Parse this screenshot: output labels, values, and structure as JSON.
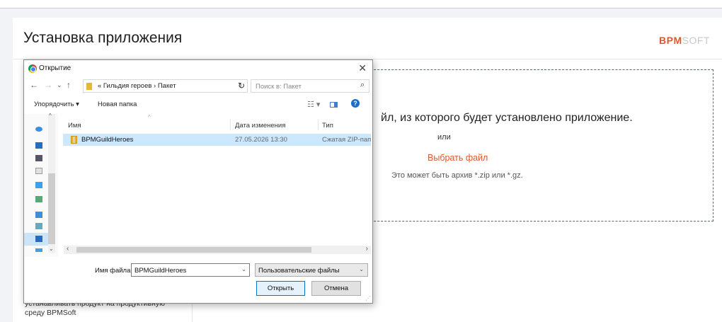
{
  "page": {
    "title": "Установка приложения",
    "brand_part1": "BPM",
    "brand_part2": "SOFT"
  },
  "drop_zone": {
    "heading": "йл, из которого будет установлено приложение.",
    "or": "или",
    "choose_file": "Выбрать файл",
    "hint": "Это может быть архив *.zip или *.gz."
  },
  "side_text": "устанавливать продукт на продуктивную среду BPMSoft",
  "dialog": {
    "title": "Открытие",
    "close": "✕",
    "breadcrumb": "« Гильдия героев › Пакет",
    "search_placeholder": "Поиск в: Пакет",
    "organize": "Упорядочить ▾",
    "new_folder": "Новая папка",
    "help": "?",
    "columns": {
      "name": "Имя",
      "date": "Дата изменения",
      "type": "Тип"
    },
    "files": [
      {
        "name": "BPMGuildHeroes",
        "date": "27.05.2026 13:30",
        "type": "Сжатая ZIP-папка"
      }
    ],
    "filename_label": "Имя файла:",
    "filename_value": "BPMGuildHeroes",
    "filter_value": "Пользовательские файлы",
    "open_button": "Открыть",
    "cancel_button": "Отмена"
  },
  "colors": {
    "accent": "#e2562b",
    "selection": "#cce8ff",
    "dialog_border": "#8c8c8c"
  }
}
